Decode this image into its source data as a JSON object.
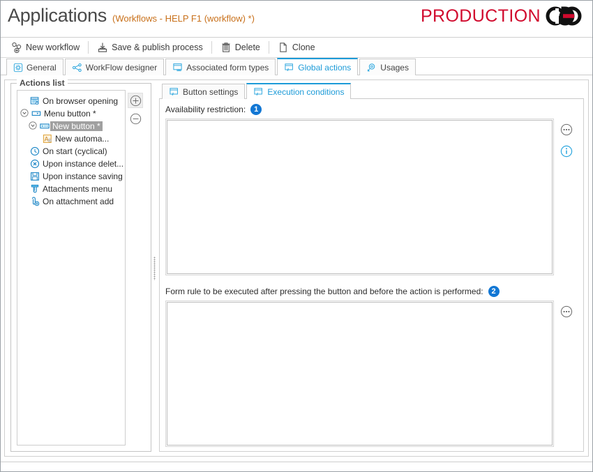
{
  "header": {
    "title": "Applications",
    "subtitle": "(Workflows - HELP F1 (workflow) *)",
    "brand": "PRODUCTION",
    "brand_color": "#d10a2e",
    "accent_color": "#1d9bd8"
  },
  "toolbar": {
    "items": [
      {
        "label": "New workflow",
        "icon": "new-workflow-icon"
      },
      {
        "label": "Save & publish process",
        "icon": "save-publish-icon"
      },
      {
        "label": "Delete",
        "icon": "trash-icon"
      },
      {
        "label": "Clone",
        "icon": "copy-icon"
      }
    ]
  },
  "tabs": [
    {
      "label": "General",
      "icon": "gear-icon",
      "active": false
    },
    {
      "label": "WorkFlow designer",
      "icon": "workflow-icon",
      "active": false
    },
    {
      "label": "Associated form types",
      "icon": "form-types-icon",
      "active": false
    },
    {
      "label": "Global actions",
      "icon": "global-actions-icon",
      "active": true
    },
    {
      "label": "Usages",
      "icon": "usages-icon",
      "active": false
    }
  ],
  "actions_list": {
    "group_title": "Actions list",
    "add_button": "+",
    "remove_button": "−",
    "items": [
      {
        "label": "On browser opening",
        "icon": "browser-opening-icon",
        "indent": 1,
        "expander": false,
        "selected": false
      },
      {
        "label": "Menu button *",
        "icon": "menu-button-icon",
        "indent": 0,
        "expander": true,
        "selected": false
      },
      {
        "label": "New button *",
        "icon": "new-button-icon",
        "indent": 1,
        "expander": true,
        "selected": true
      },
      {
        "label": "New automa...",
        "icon": "automation-icon",
        "indent": 2,
        "expander": false,
        "selected": false
      },
      {
        "label": "On start (cyclical)",
        "icon": "clock-icon",
        "indent": 1,
        "expander": false,
        "selected": false
      },
      {
        "label": "Upon instance delet...",
        "icon": "delete-instance-icon",
        "indent": 1,
        "expander": false,
        "selected": false
      },
      {
        "label": "Upon instance saving",
        "icon": "save-instance-icon",
        "indent": 1,
        "expander": false,
        "selected": false
      },
      {
        "label": "Attachments menu",
        "icon": "attachments-menu-icon",
        "indent": 1,
        "expander": false,
        "selected": false
      },
      {
        "label": "On attachment add",
        "icon": "attachment-add-icon",
        "indent": 1,
        "expander": false,
        "selected": false
      }
    ]
  },
  "inner_tabs": [
    {
      "label": "Button settings",
      "icon": "button-settings-icon",
      "active": false
    },
    {
      "label": "Execution conditions",
      "icon": "execution-conditions-icon",
      "active": true
    }
  ],
  "fields": {
    "availability": {
      "label": "Availability restriction:",
      "badge": "1",
      "value": "",
      "ellipsis_icon": "ellipsis-icon",
      "info_icon": "info-icon"
    },
    "form_rule": {
      "label": "Form rule to be executed after pressing the button and before the action is performed:",
      "badge": "2",
      "value": "",
      "ellipsis_icon": "ellipsis-icon"
    }
  }
}
